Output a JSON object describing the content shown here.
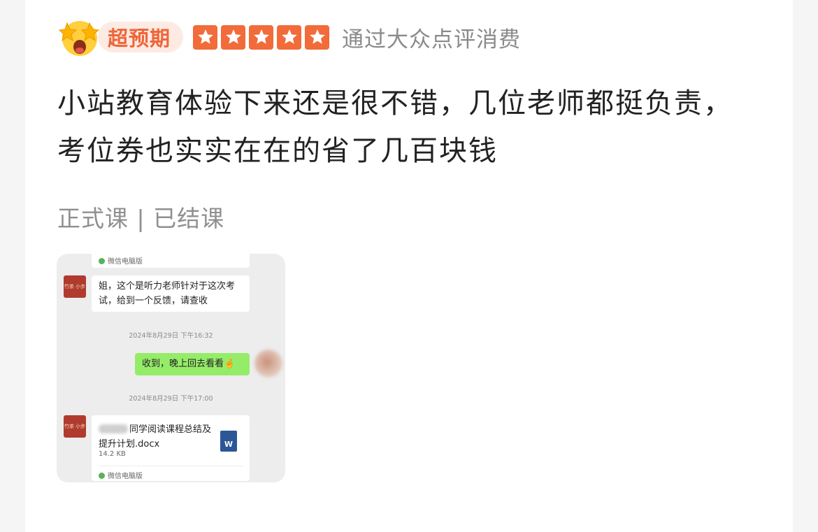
{
  "header": {
    "emoji_icon": "star-struck-face-icon",
    "badge_label": "超预期",
    "rating": 5,
    "source": "通过大众点评消费"
  },
  "review": {
    "text": "小站教育体验下来还是很不错，几位老师都挺负责，考位券也实实在在的省了几百块钱",
    "tags": "正式课 | 已结课"
  },
  "photo": {
    "top_bubble_footer": "微信电脑版",
    "avatar_text": "竹茶 小步",
    "msg1": "姐，这个是听力老师针对于这次考试，给到一个反馈，请查收",
    "time1": "2024年8月29日 下午16:32",
    "msg2": "收到，晚上回去看看🤞",
    "time2": "2024年8月29日 下午17:00",
    "file_name": "同学阅读课程总结及提升计划.docx",
    "file_size": "14.2 KB",
    "file_icon": "W",
    "bottom_footer": "微信电脑版"
  },
  "colors": {
    "accent": "#f26b3a",
    "badge_bg": "#fdebe3",
    "wechat_green": "#95ec69"
  }
}
